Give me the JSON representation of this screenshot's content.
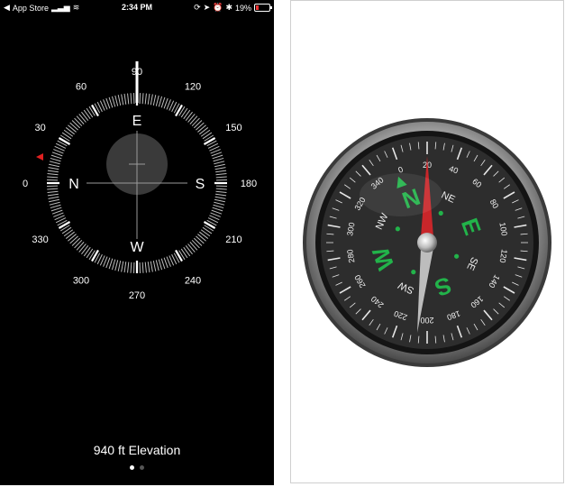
{
  "status_bar": {
    "back_app": "App Store",
    "time": "2:34 PM",
    "battery": "19%",
    "battery_level": 0.19
  },
  "phone_compass": {
    "heading_degrees": 0,
    "degree_labels": [
      "0",
      "30",
      "60",
      "90",
      "120",
      "150",
      "180",
      "210",
      "240",
      "270",
      "300",
      "330"
    ],
    "cardinal_labels": [
      "N",
      "E",
      "S",
      "W"
    ],
    "elevation": "940 ft Elevation",
    "page_count": 2,
    "active_page": 1,
    "colors": {
      "background": "#000000",
      "foreground": "#ffffff",
      "heading_marker": "#e02020"
    }
  },
  "analog_compass": {
    "image": "photo of a magnetic compass",
    "cardinal_labels": [
      "N",
      "E",
      "S",
      "W"
    ],
    "intercardinal_labels": [
      "NE",
      "SE",
      "SW",
      "NW"
    ],
    "degree_labels": [
      "0",
      "20",
      "40",
      "60",
      "80",
      "100",
      "120",
      "140",
      "160",
      "180",
      "200",
      "220",
      "240",
      "260",
      "280",
      "300",
      "320",
      "340"
    ],
    "colors": {
      "dial": "#2b2b2b",
      "cardinal": "#22b34a",
      "needle_north": "#c8262a",
      "needle_south": "#b8b8b8"
    }
  }
}
